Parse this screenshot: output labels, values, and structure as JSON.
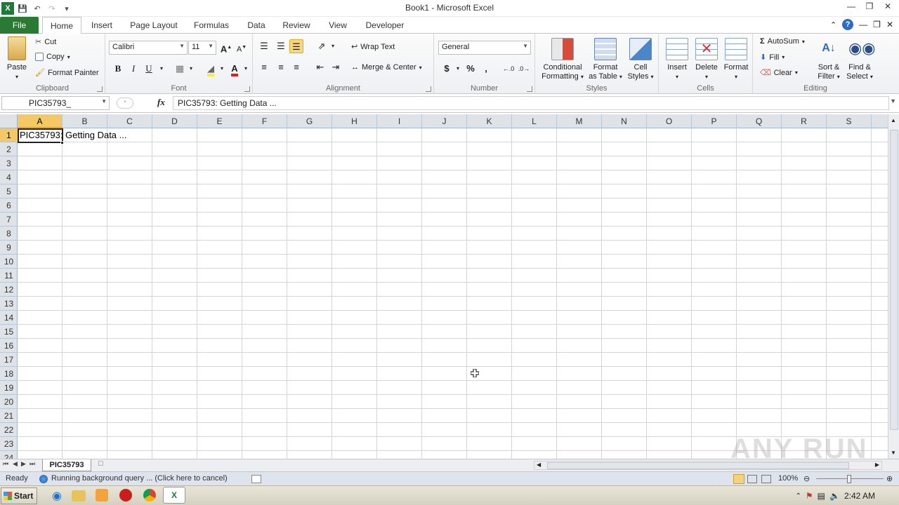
{
  "window": {
    "title": "Book1 - Microsoft Excel"
  },
  "ribbon_tabs": [
    "File",
    "Home",
    "Insert",
    "Page Layout",
    "Formulas",
    "Data",
    "Review",
    "View",
    "Developer"
  ],
  "clipboard": {
    "paste": "Paste",
    "cut": "Cut",
    "copy": "Copy",
    "format_painter": "Format Painter",
    "label": "Clipboard"
  },
  "font": {
    "name": "Calibri",
    "size": "11",
    "bold": "B",
    "italic": "I",
    "underline": "U",
    "label": "Font"
  },
  "alignment": {
    "wrap_text": "Wrap Text",
    "merge_center": "Merge & Center",
    "label": "Alignment"
  },
  "number": {
    "format": "General",
    "currency": "$",
    "percent": "%",
    "comma": ",",
    "label": "Number"
  },
  "styles": {
    "conditional_formatting": [
      "Conditional",
      "Formatting"
    ],
    "format_as_table": [
      "Format",
      "as Table"
    ],
    "cell_styles": [
      "Cell",
      "Styles"
    ],
    "label": "Styles"
  },
  "cells_group": {
    "insert": "Insert",
    "delete": "Delete",
    "format": "Format",
    "label": "Cells"
  },
  "editing": {
    "autosum": "AutoSum",
    "fill": "Fill",
    "clear": "Clear",
    "sort_filter": [
      "Sort &",
      "Filter"
    ],
    "find_select": [
      "Find &",
      "Select"
    ],
    "label": "Editing"
  },
  "formula_bar": {
    "name_box": "PIC35793_",
    "fx": "fx",
    "content": "PIC35793: Getting Data ..."
  },
  "grid": {
    "columns": [
      "A",
      "B",
      "C",
      "D",
      "E",
      "F",
      "G",
      "H",
      "I",
      "J",
      "K",
      "L",
      "M",
      "N",
      "O",
      "P",
      "Q",
      "R",
      "S"
    ],
    "rows": [
      "1",
      "2",
      "3",
      "4",
      "5",
      "6",
      "7",
      "8",
      "9",
      "10",
      "11",
      "12",
      "13",
      "14",
      "15",
      "16",
      "17",
      "18",
      "19",
      "20",
      "21",
      "22",
      "23",
      "24"
    ],
    "active_column": "A",
    "active_row": "1",
    "cell_a1": "PIC35793: Getting Data ..."
  },
  "sheets": {
    "active": "PIC35793"
  },
  "status": {
    "ready": "Ready",
    "query": "Running background query ...  (Click here to cancel)",
    "zoom": "100%"
  },
  "taskbar": {
    "start": "Start",
    "clock": "2:42 AM"
  },
  "watermark": "ANY RUN",
  "colors": {
    "file_tab": "#2b7a33",
    "active_header": "#f4c864",
    "header_bg": "#dfe3e8"
  }
}
